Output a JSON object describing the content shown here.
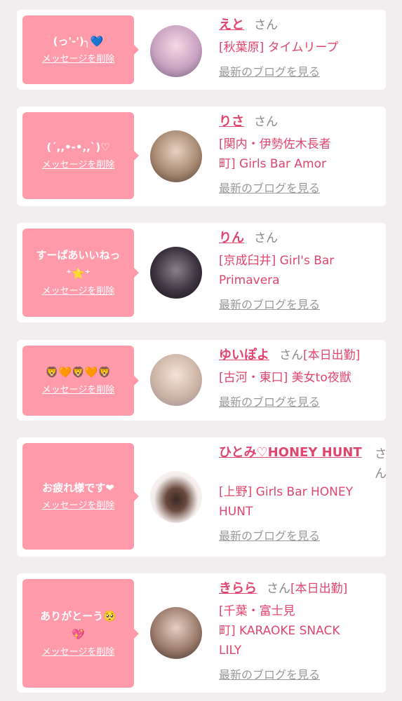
{
  "colors": {
    "accent": "#e0456d",
    "bubble": "#ff9aab",
    "background": "#f2eef0"
  },
  "delete_label": "メッセージを削除",
  "blog_label": "最新のブログを見る",
  "cards": [
    {
      "message": "(っ'-')╮💙",
      "name": "えと",
      "san": "さん",
      "status": "",
      "shop": "[秋葉原] タイムリープ"
    },
    {
      "message": "(´,,•-•,,`)♡",
      "name": "りさ",
      "san": "さん",
      "status": "",
      "shop": "[関内・伊勢佐木長者\n町] Girls Bar Amor"
    },
    {
      "message": "すーぱあいいねっ\n⁺⭐⁺",
      "name": "りん",
      "san": "さん",
      "status": "",
      "shop": "[京成臼井] Girl's Bar\nPrimavera"
    },
    {
      "message": "🦁🧡🦁🧡🦁",
      "name": "ゆいぽよ",
      "san": "さん",
      "status": "[本日出勤]",
      "shop": "[古河・東口] 美女to夜獣"
    },
    {
      "message": "お疲れ様です❤",
      "name": "ひとみ♡HONEY HUNT",
      "san": "さ\nん",
      "status": "",
      "shop": "[上野] Girls Bar HONEY\nHUNT"
    },
    {
      "message": "ありがとーう🥺\n💖",
      "name": "きらら",
      "san": "さん",
      "status": "[本日出勤]",
      "shop": "[千葉・富士見\n町] KARAOKE SNACK\nLILY"
    }
  ]
}
